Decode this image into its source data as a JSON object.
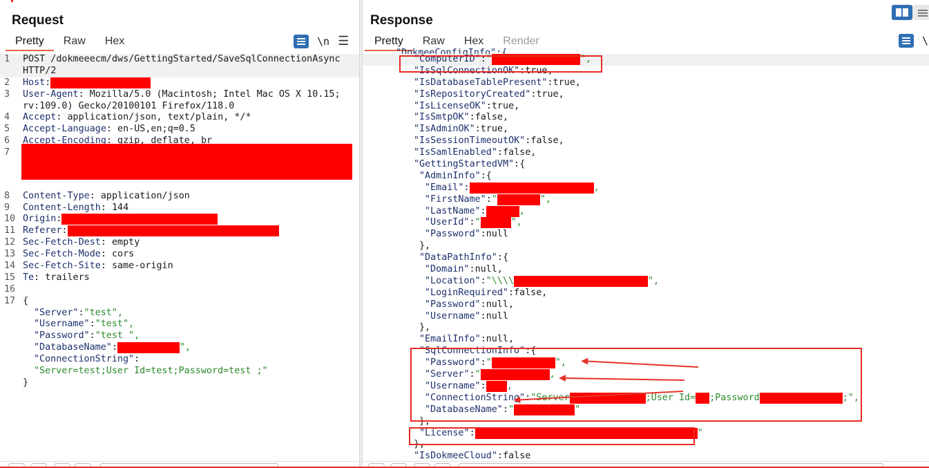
{
  "request": {
    "title": "Request",
    "tabs": [
      "Pretty",
      "Raw",
      "Hex"
    ],
    "newline_label": "\\n",
    "lines": [
      {
        "n": "1",
        "key": "",
        "text": "POST /dokmeeecm/dws/GettingStarted/SaveSqlConnectionAsync"
      },
      {
        "n": "",
        "key": "",
        "text": "HTTP/2"
      },
      {
        "n": "2",
        "key": "Host",
        "text": ""
      },
      {
        "n": "3",
        "key": "User-Agent",
        "text": " Mozilla/5.0 (Macintosh; Intel Mac OS X 10.15;"
      },
      {
        "n": "",
        "key": "",
        "text": "rv:109.0) Gecko/20100101 Firefox/118.0"
      },
      {
        "n": "4",
        "key": "Accept",
        "text": " application/json, text/plain, */*"
      },
      {
        "n": "5",
        "key": "Accept-Language",
        "text": " en-US,en;q=0.5"
      },
      {
        "n": "6",
        "key": "Accept-Encoding",
        "text": " gzip, deflate, br"
      },
      {
        "n": "7",
        "key": "",
        "text": ""
      },
      {
        "n": "8",
        "key": "Content-Type",
        "text": " application/json"
      },
      {
        "n": "9",
        "key": "Content-Length",
        "text": " 144"
      },
      {
        "n": "10",
        "key": "Origin",
        "text": ""
      },
      {
        "n": "11",
        "key": "Referer",
        "text": ""
      },
      {
        "n": "12",
        "key": "Sec-Fetch-Dest",
        "text": " empty"
      },
      {
        "n": "13",
        "key": "Sec-Fetch-Mode",
        "text": " cors"
      },
      {
        "n": "14",
        "key": "Sec-Fetch-Site",
        "text": " same-origin"
      },
      {
        "n": "15",
        "key": "Te",
        "text": " trailers"
      },
      {
        "n": "16",
        "key": "",
        "text": ""
      },
      {
        "n": "17",
        "key": "",
        "text": "{"
      }
    ],
    "body": [
      {
        "key": "\"Server\"",
        "val": "\"test\","
      },
      {
        "key": "\"Username\"",
        "val": "\"test\","
      },
      {
        "key": "\"Password\"",
        "val": "\"test \","
      },
      {
        "key": "\"DatabaseName\"",
        "val": "\","
      },
      {
        "key": "\"ConnectionString\"",
        "val": ""
      },
      {
        "key": "",
        "val": "\"Server=test;User Id=test;Password=test ;\""
      },
      {
        "key": "",
        "val": "}"
      }
    ]
  },
  "response": {
    "title": "Response",
    "tabs": [
      "Pretty",
      "Raw",
      "Hex",
      "Render"
    ],
    "newline_label": "\\n",
    "cut_top": "\"DokmeeConfigInfo\":{",
    "lines": [
      {
        "indent": 4,
        "key": "\"ComputerID\"",
        "val": "\"",
        "tail": "\","
      },
      {
        "indent": 4,
        "key": "\"IsSqlConnectionOK\"",
        "val": "true,"
      },
      {
        "indent": 4,
        "key": "\"IsDatabaseTablePresent\"",
        "val": "true,"
      },
      {
        "indent": 4,
        "key": "\"IsRepositoryCreated\"",
        "val": "true,"
      },
      {
        "indent": 4,
        "key": "\"IsLicenseOK\"",
        "val": "true,"
      },
      {
        "indent": 4,
        "key": "\"IsSmtpOK\"",
        "val": "false,"
      },
      {
        "indent": 4,
        "key": "\"IsAdminOK\"",
        "val": "true,"
      },
      {
        "indent": 4,
        "key": "\"IsSessionTimeoutOK\"",
        "val": "false,"
      },
      {
        "indent": 4,
        "key": "\"IsSamlEnabled\"",
        "val": "false,"
      },
      {
        "indent": 4,
        "key": "\"GettingStartedVM\"",
        "val": "{"
      },
      {
        "indent": 6,
        "key": "\"AdminInfo\"",
        "val": "{"
      },
      {
        "indent": 8,
        "key": "\"Email\"",
        "val": "",
        "tail": ","
      },
      {
        "indent": 8,
        "key": "\"FirstName\"",
        "val": "\"",
        "tail": "\","
      },
      {
        "indent": 8,
        "key": "\"LastName\"",
        "val": "",
        "tail": ","
      },
      {
        "indent": 8,
        "key": "\"UserId\"",
        "val": "\"",
        "tail": "\","
      },
      {
        "indent": 8,
        "key": "\"Password\"",
        "val": "null"
      },
      {
        "indent": 6,
        "key": "",
        "val": "},"
      },
      {
        "indent": 6,
        "key": "\"DataPathInfo\"",
        "val": "{"
      },
      {
        "indent": 8,
        "key": "\"Domain\"",
        "val": "null,"
      },
      {
        "indent": 8,
        "key": "\"Location\"",
        "val": "\"\\\\\\\\",
        "tail": "\","
      },
      {
        "indent": 8,
        "key": "\"LoginRequired\"",
        "val": "false,"
      },
      {
        "indent": 8,
        "key": "\"Password\"",
        "val": "null,"
      },
      {
        "indent": 8,
        "key": "\"Username\"",
        "val": "null"
      },
      {
        "indent": 6,
        "key": "",
        "val": "},"
      },
      {
        "indent": 6,
        "key": "\"EmailInfo\"",
        "val": "null,"
      },
      {
        "indent": 6,
        "key": "\"SqlConnectionInfo\"",
        "val": "{"
      },
      {
        "indent": 8,
        "key": "\"Password\"",
        "val": "\"",
        "tail": "\","
      },
      {
        "indent": 8,
        "key": "\"Server\"",
        "val": "\"",
        "tail": ","
      },
      {
        "indent": 8,
        "key": "\"Username\"",
        "val": "",
        "tail": ","
      },
      {
        "indent": 8,
        "key": "\"ConnectionString\"",
        "val": "\"Server",
        "mid1": ";User Id=",
        "mid2": ";Password",
        "tail": ";\","
      },
      {
        "indent": 8,
        "key": "\"DatabaseName\"",
        "val": "\"",
        "tail": "\""
      },
      {
        "indent": 6,
        "key": "",
        "val": "},"
      },
      {
        "indent": 6,
        "key": "\"License\"",
        "val": "",
        "tail": "\""
      },
      {
        "indent": 4,
        "key": "",
        "val": "},"
      },
      {
        "indent": 4,
        "key": "\"IsDokmeeCloud\"",
        "val": "false"
      }
    ]
  },
  "colors": {
    "accent_tab": "#e8623d",
    "highlight_box": "#e52a22",
    "redaction": "#ff0000",
    "json_key": "#1c2f6b",
    "json_string": "#2c8a2c",
    "tool_blue": "#2f6fb3"
  }
}
